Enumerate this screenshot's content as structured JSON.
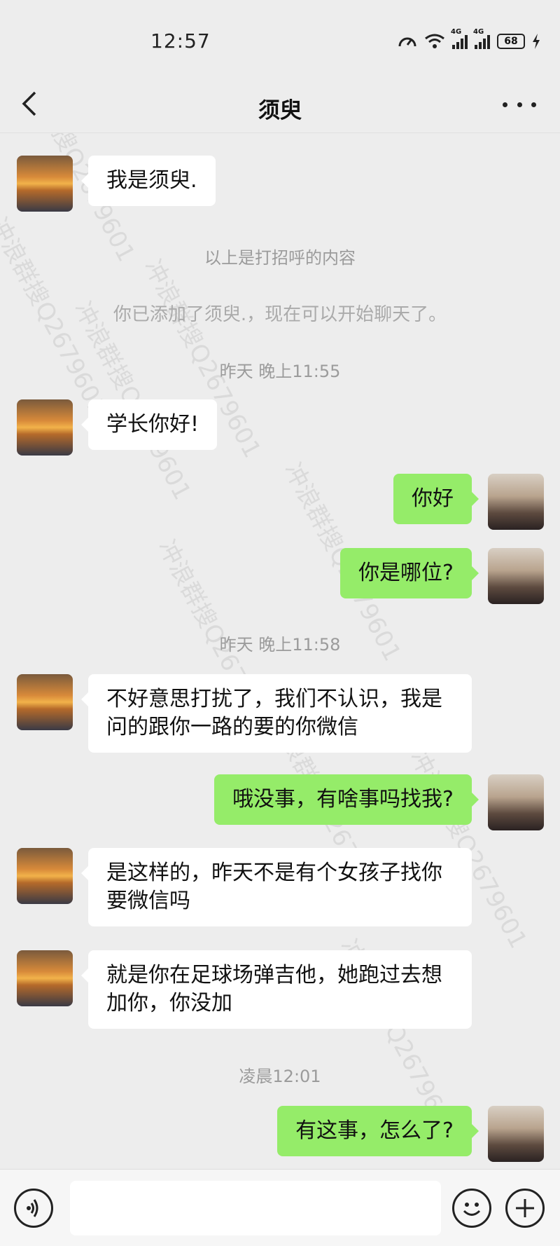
{
  "status": {
    "time": "12:57",
    "network1": "4G",
    "network2": "4G",
    "battery": "68"
  },
  "header": {
    "title": "须臾"
  },
  "system_messages": {
    "greeting_note": "以上是打招呼的内容",
    "added_note": "你已添加了须臾.，现在可以开始聊天了。",
    "time1": "昨天 晚上11:55",
    "time2": "昨天 晚上11:58",
    "time3": "凌晨12:01"
  },
  "messages": [
    {
      "from": "peer",
      "text": "我是须臾."
    },
    {
      "from": "peer",
      "text": "学长你好!"
    },
    {
      "from": "me",
      "text": "你好"
    },
    {
      "from": "me",
      "text": "你是哪位?"
    },
    {
      "from": "peer",
      "text": "不好意思打扰了，我们不认识，我是问的跟你一路的要的你微信"
    },
    {
      "from": "me",
      "text": "哦没事，有啥事吗找我?"
    },
    {
      "from": "peer",
      "text": "是这样的，昨天不是有个女孩子找你要微信吗"
    },
    {
      "from": "peer",
      "text": "就是你在足球场弹吉他，她跑过去想加你，你没加"
    },
    {
      "from": "me",
      "text": "有这事，怎么了?"
    }
  ],
  "watermark": "冲浪群搜Q2679601",
  "colors": {
    "background": "#ededed",
    "my_bubble": "#95ec69",
    "peer_bubble": "#ffffff"
  },
  "icons": {
    "back": "chevron-left-icon",
    "more": "more-dots-icon",
    "voice": "voice-icon",
    "emoji": "emoji-icon",
    "plus": "plus-icon"
  }
}
